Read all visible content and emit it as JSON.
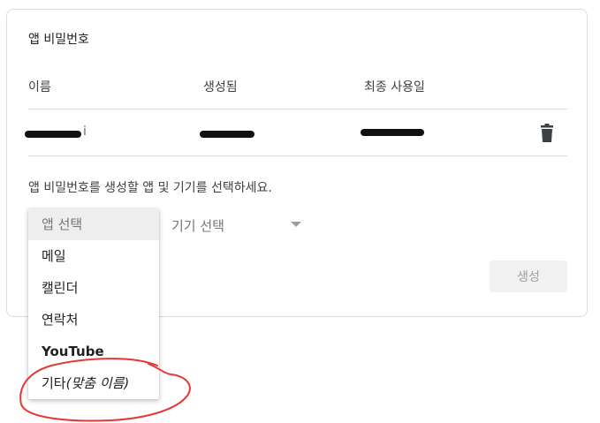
{
  "card": {
    "title": "앱 비밀번호",
    "columns": {
      "name": "이름",
      "created": "생성됨",
      "last_used": "최종 사용일"
    },
    "instruction": "앱 비밀번호를 생성할 앱 및 기기를 선택하세요.",
    "row": {
      "name_suffix": "i"
    },
    "device_select": {
      "label": "기기 선택"
    },
    "generate_button": "생성"
  },
  "app_menu": {
    "items": [
      {
        "label": "앱 선택"
      },
      {
        "label": "메일"
      },
      {
        "label": "캘린더"
      },
      {
        "label": "연락처"
      },
      {
        "label": "YouTube"
      },
      {
        "label_prefix": "기타",
        "label_italic": "(맞춤 이름)"
      }
    ],
    "selected_index": 0
  },
  "annotation": {
    "color": "#e53935",
    "shape": "hand-drawn circle around last menu item"
  },
  "colors": {
    "border": "#dadce0",
    "muted_text": "#757575",
    "redaction": "#111111"
  }
}
